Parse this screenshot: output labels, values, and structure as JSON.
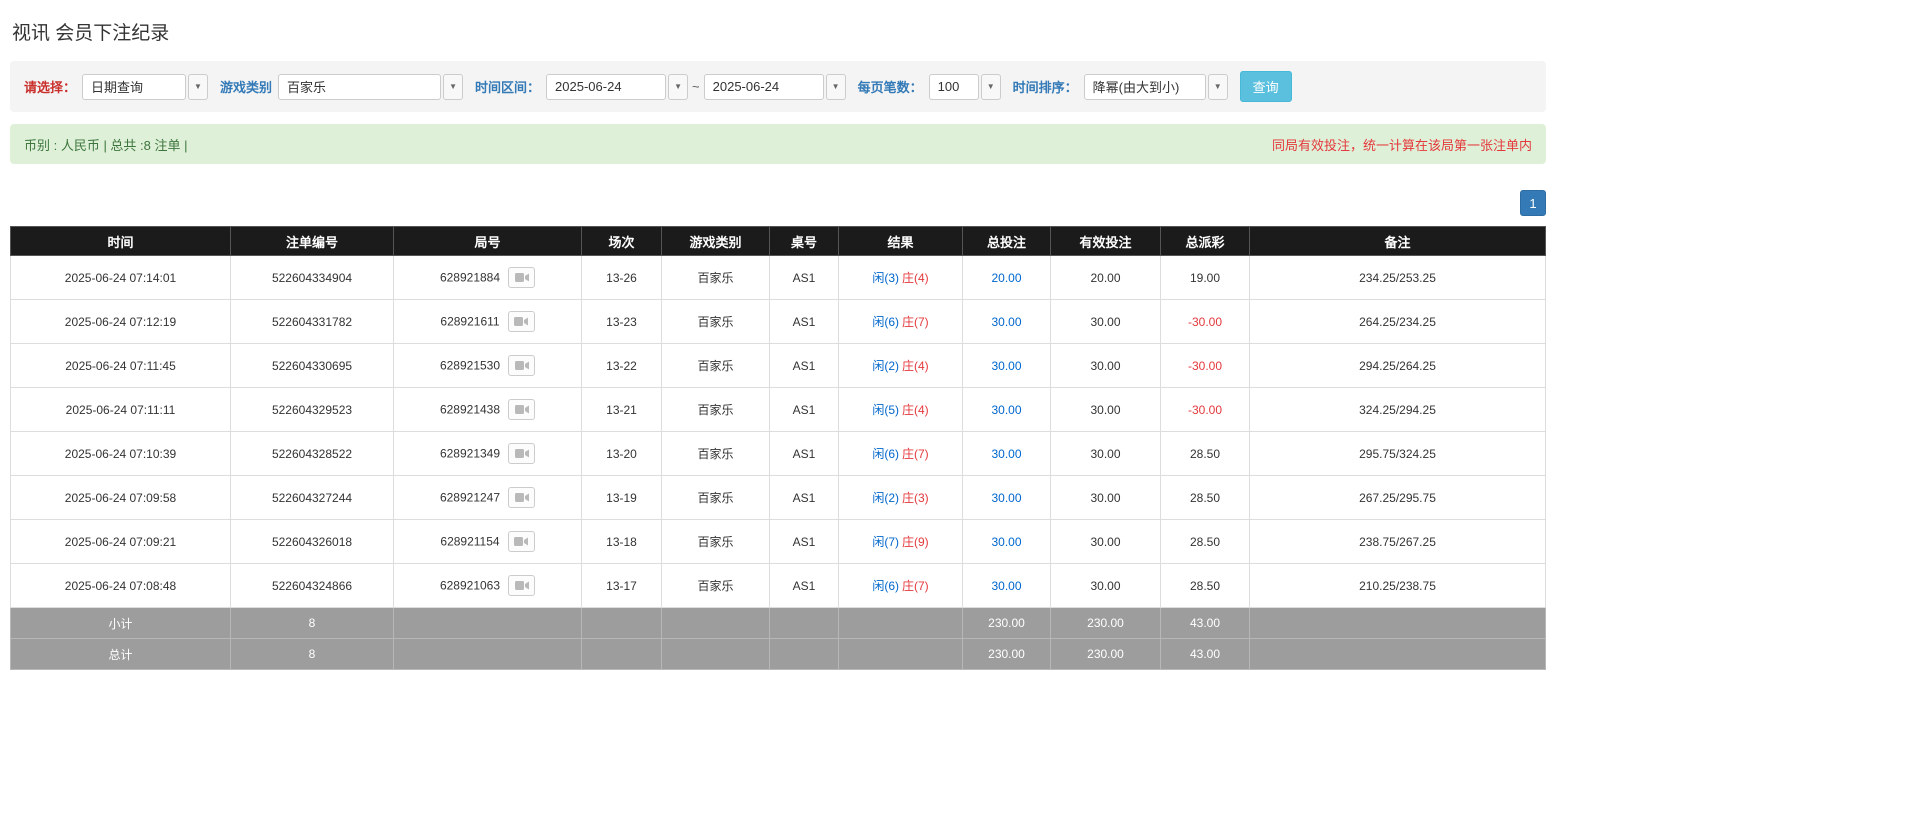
{
  "page": {
    "title": "视讯 会员下注纪录"
  },
  "colors": {
    "accent_blue": "#337ab7",
    "link_blue": "#0066cc",
    "danger_red": "#e4393c",
    "label_red": "#c9302c",
    "search_button_bg": "#5bc0de",
    "summary_bg": "#dff0d8",
    "table_header_bg": "#1b1b1b",
    "table_footer_bg": "#9d9d9d"
  },
  "filters": {
    "select_label": "请选择：",
    "select_value": "日期查询",
    "game_type_label": "游戏类别",
    "game_type_value": "百家乐",
    "time_range_label": "时间区间：",
    "date_from": "2025-06-24",
    "tilde": "~",
    "date_to": "2025-06-24",
    "page_size_label": "每页笔数：",
    "page_size_value": "100",
    "sort_label": "时间排序：",
    "sort_value": "降幂(由大到小)",
    "search_button": "查询"
  },
  "summary": {
    "left": "币别 : 人民币 | 总共 :8 注单 |",
    "right": "同局有效投注，统一计算在该局第一张注单内"
  },
  "pagination": {
    "current": "1"
  },
  "table": {
    "headers": [
      "时间",
      "注单编号",
      "局号",
      "场次",
      "游戏类别",
      "桌号",
      "结果",
      "总投注",
      "有效投注",
      "总派彩",
      "备注"
    ],
    "rows": [
      {
        "time": "2025-06-24 07:14:01",
        "bet_id": "522604334904",
        "round": "628921884",
        "session": "13-26",
        "game": "百家乐",
        "table_no": "AS1",
        "result_player": "闲(3)",
        "result_banker": "庄(4)",
        "total_bet": "20.00",
        "valid_bet": "20.00",
        "payout": "19.00",
        "note": "234.25/253.25"
      },
      {
        "time": "2025-06-24 07:12:19",
        "bet_id": "522604331782",
        "round": "628921611",
        "session": "13-23",
        "game": "百家乐",
        "table_no": "AS1",
        "result_player": "闲(6)",
        "result_banker": "庄(7)",
        "total_bet": "30.00",
        "valid_bet": "30.00",
        "payout": "-30.00",
        "note": "264.25/234.25"
      },
      {
        "time": "2025-06-24 07:11:45",
        "bet_id": "522604330695",
        "round": "628921530",
        "session": "13-22",
        "game": "百家乐",
        "table_no": "AS1",
        "result_player": "闲(2)",
        "result_banker": "庄(4)",
        "total_bet": "30.00",
        "valid_bet": "30.00",
        "payout": "-30.00",
        "note": "294.25/264.25"
      },
      {
        "time": "2025-06-24 07:11:11",
        "bet_id": "522604329523",
        "round": "628921438",
        "session": "13-21",
        "game": "百家乐",
        "table_no": "AS1",
        "result_player": "闲(5)",
        "result_banker": "庄(4)",
        "total_bet": "30.00",
        "valid_bet": "30.00",
        "payout": "-30.00",
        "note": "324.25/294.25"
      },
      {
        "time": "2025-06-24 07:10:39",
        "bet_id": "522604328522",
        "round": "628921349",
        "session": "13-20",
        "game": "百家乐",
        "table_no": "AS1",
        "result_player": "闲(6)",
        "result_banker": "庄(7)",
        "total_bet": "30.00",
        "valid_bet": "30.00",
        "payout": "28.50",
        "note": "295.75/324.25"
      },
      {
        "time": "2025-06-24 07:09:58",
        "bet_id": "522604327244",
        "round": "628921247",
        "session": "13-19",
        "game": "百家乐",
        "table_no": "AS1",
        "result_player": "闲(2)",
        "result_banker": "庄(3)",
        "total_bet": "30.00",
        "valid_bet": "30.00",
        "payout": "28.50",
        "note": "267.25/295.75"
      },
      {
        "time": "2025-06-24 07:09:21",
        "bet_id": "522604326018",
        "round": "628921154",
        "session": "13-18",
        "game": "百家乐",
        "table_no": "AS1",
        "result_player": "闲(7)",
        "result_banker": "庄(9)",
        "total_bet": "30.00",
        "valid_bet": "30.00",
        "payout": "28.50",
        "note": "238.75/267.25"
      },
      {
        "time": "2025-06-24 07:08:48",
        "bet_id": "522604324866",
        "round": "628921063",
        "session": "13-17",
        "game": "百家乐",
        "table_no": "AS1",
        "result_player": "闲(6)",
        "result_banker": "庄(7)",
        "total_bet": "30.00",
        "valid_bet": "30.00",
        "payout": "28.50",
        "note": "210.25/238.75"
      }
    ],
    "subtotal": {
      "label": "小计",
      "count": "8",
      "total_bet": "230.00",
      "valid_bet": "230.00",
      "payout": "43.00"
    },
    "total": {
      "label": "总计",
      "count": "8",
      "total_bet": "230.00",
      "valid_bet": "230.00",
      "payout": "43.00"
    }
  }
}
